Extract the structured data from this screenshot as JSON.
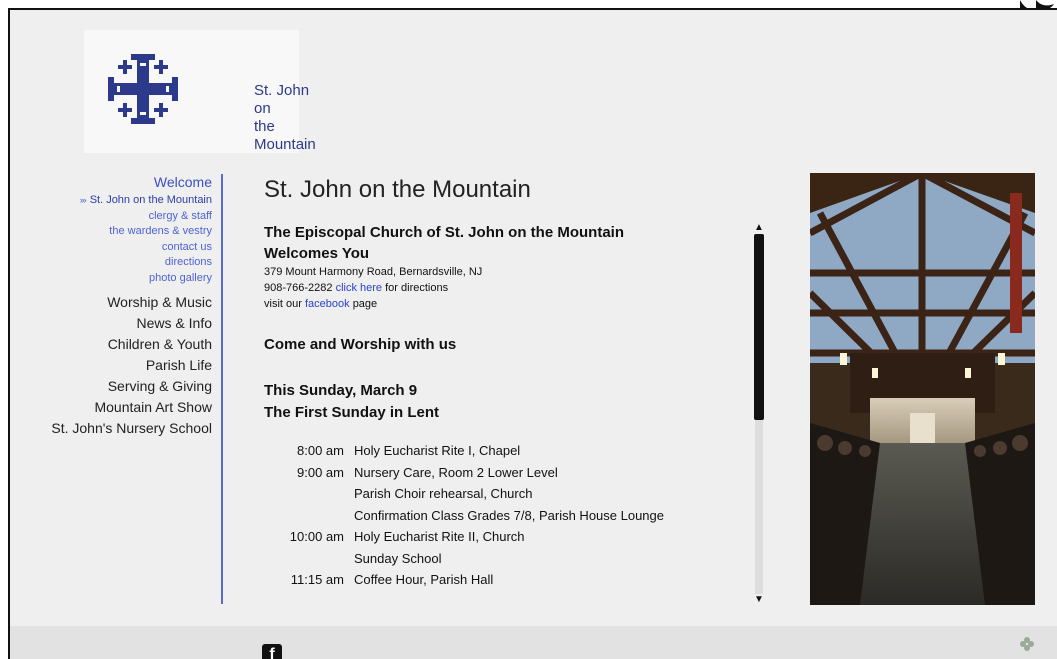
{
  "logo": {
    "line1": "St. John on",
    "line2": "the Mountain",
    "color": "#2d3a8c"
  },
  "nav": {
    "welcome": "Welcome",
    "sub_items": [
      {
        "label": "St. John on the Mountain",
        "active": true
      },
      {
        "label": "clergy & staff"
      },
      {
        "label": "the wardens  & vestry"
      },
      {
        "label": "contact us"
      },
      {
        "label": "directions"
      },
      {
        "label": "photo gallery"
      }
    ],
    "primary_items": [
      {
        "label": "Worship & Music"
      },
      {
        "label": "News & Info"
      },
      {
        "label": "Children & Youth"
      },
      {
        "label": "Parish Life"
      },
      {
        "label": "Serving & Giving"
      },
      {
        "label": "Mountain Art Show"
      },
      {
        "label": "St. John's Nursery School"
      }
    ],
    "accent_color": "#4f62d6"
  },
  "main": {
    "title": "St. John on the Mountain",
    "heading_line1": "The Episcopal Church of St. John on the Mountain",
    "heading_line2": "Welcomes You",
    "address": "379 Mount Harmony Road, Bernardsville, NJ",
    "phone": "908-766-2282",
    "directions_link": "click here",
    "directions_suffix": "for directions",
    "visit_prefix": "visit our",
    "facebook_link": "facebook",
    "visit_suffix": "page",
    "worship_heading": "Come and Worship with us",
    "sunday_line1": "This Sunday, March 9",
    "sunday_line2": "The First Sunday in Lent",
    "schedule": [
      {
        "time": "8:00 am",
        "activity": "Holy Eucharist Rite I, Chapel"
      },
      {
        "time": "9:00 am",
        "activity": "Nursery Care, Room 2 Lower Level"
      },
      {
        "time": "",
        "activity": "Parish Choir rehearsal, Church"
      },
      {
        "time": "",
        "activity": "Confirmation Class Grades 7/8, Parish House Lounge"
      },
      {
        "time": "10:00 am",
        "activity": "Holy Eucharist Rite II, Church"
      },
      {
        "time": "",
        "activity": " Sunday School"
      },
      {
        "time": "11:15 am",
        "activity": "Coffee Hour, Parish Hall"
      }
    ]
  },
  "icons": {
    "scroll_up": "scroll-up-arrow-icon",
    "scroll_down": "scroll-down-arrow-icon",
    "footer_social": "facebook-icon",
    "footer_right": "clover-icon",
    "corner": "leaf-icon"
  }
}
